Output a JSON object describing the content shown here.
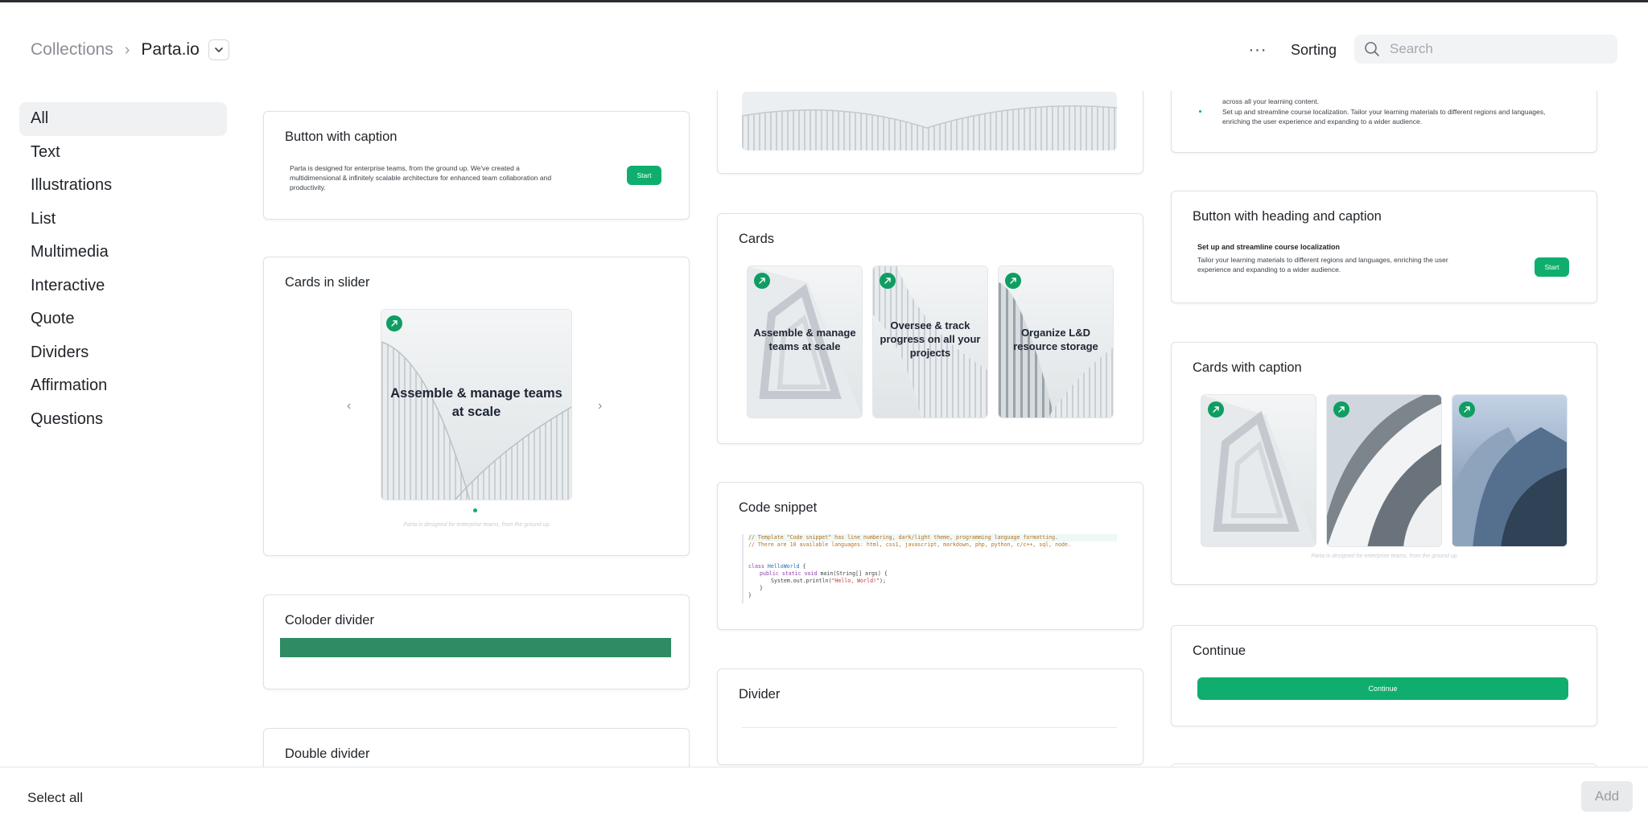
{
  "header": {
    "breadcrumb_root": "Collections",
    "breadcrumb_separator": "›",
    "breadcrumb_current": "Parta.io",
    "more_label": "···",
    "sorting_label": "Sorting",
    "search_placeholder": "Search"
  },
  "sidebar": {
    "items": [
      {
        "label": "All",
        "active": true
      },
      {
        "label": "Text"
      },
      {
        "label": "Illustrations"
      },
      {
        "label": "List"
      },
      {
        "label": "Multimedia"
      },
      {
        "label": "Interactive"
      },
      {
        "label": "Quote"
      },
      {
        "label": "Dividers"
      },
      {
        "label": "Affirmation"
      },
      {
        "label": "Questions"
      }
    ]
  },
  "cards": {
    "button_caption": {
      "title": "Button with caption",
      "text": "Parta is designed for enterprise teams, from the ground up. We've created a multidimensional & infinitely scalable architecture for enhanced team collaboration and productivity.",
      "button": "Start"
    },
    "cards_slider": {
      "title": "Cards in slider",
      "slide_text": "Assemble & manage teams at scale",
      "caption": "Parta is designed for enterprise teams, from the ground up.",
      "prev": "‹",
      "next": "›"
    },
    "colored_divider": {
      "title": "Coloder divider",
      "color": "#2e8b62"
    },
    "double_divider": {
      "title": "Double divider"
    },
    "cards": {
      "title": "Cards",
      "tiles": [
        "Assemble & manage teams at scale",
        "Oversee & track progress on all your projects",
        "Organize L&D resource storage"
      ]
    },
    "code_snippet": {
      "title": "Code snippet",
      "comment_1": "// Template \"Code snippet\" has line numbering, dark/light theme, programming language formatting.",
      "comment_2": "// There are 10 available languages: html, css1, javascript, markdown, php, python, c/c++, sql, node.",
      "kw_class": "class",
      "class_name": "HelloWorld",
      "brace_open": " {",
      "kw_method": "public static void",
      "method_sig": " main(String[] args) {",
      "println": "System.out.println(",
      "string": "\"Hello, World!\"",
      "close_call": ");",
      "brace_inner": "}",
      "brace_outer": "}"
    },
    "divider": {
      "title": "Divider"
    },
    "list_partial": {
      "line1": "across all your learning content.",
      "line2": "Set up and streamline course localization. Tailor your learning materials to different regions and languages, enriching the user experience and expanding to a wider audience."
    },
    "button_heading_caption": {
      "title": "Button with heading and caption",
      "heading": "Set up and streamline course localization",
      "text": "Tailor your learning materials to different regions and languages, enriching the user experience and expanding to a wider audience.",
      "button": "Start"
    },
    "cards_caption": {
      "title": "Cards with caption",
      "caption": "Parta is designed for enterprise teams, from the ground up."
    },
    "continue": {
      "title": "Continue",
      "button": "Continue"
    }
  },
  "footer": {
    "select_all": "Select all",
    "add": "Add"
  },
  "colors": {
    "accent": "#0fae6e",
    "badge": "#0f9d63",
    "divider_green": "#2e8b62"
  },
  "icons": [
    "chevron-down-icon",
    "search-icon",
    "arrow-up-right-icon",
    "chevron-left-icon",
    "chevron-right-icon"
  ]
}
